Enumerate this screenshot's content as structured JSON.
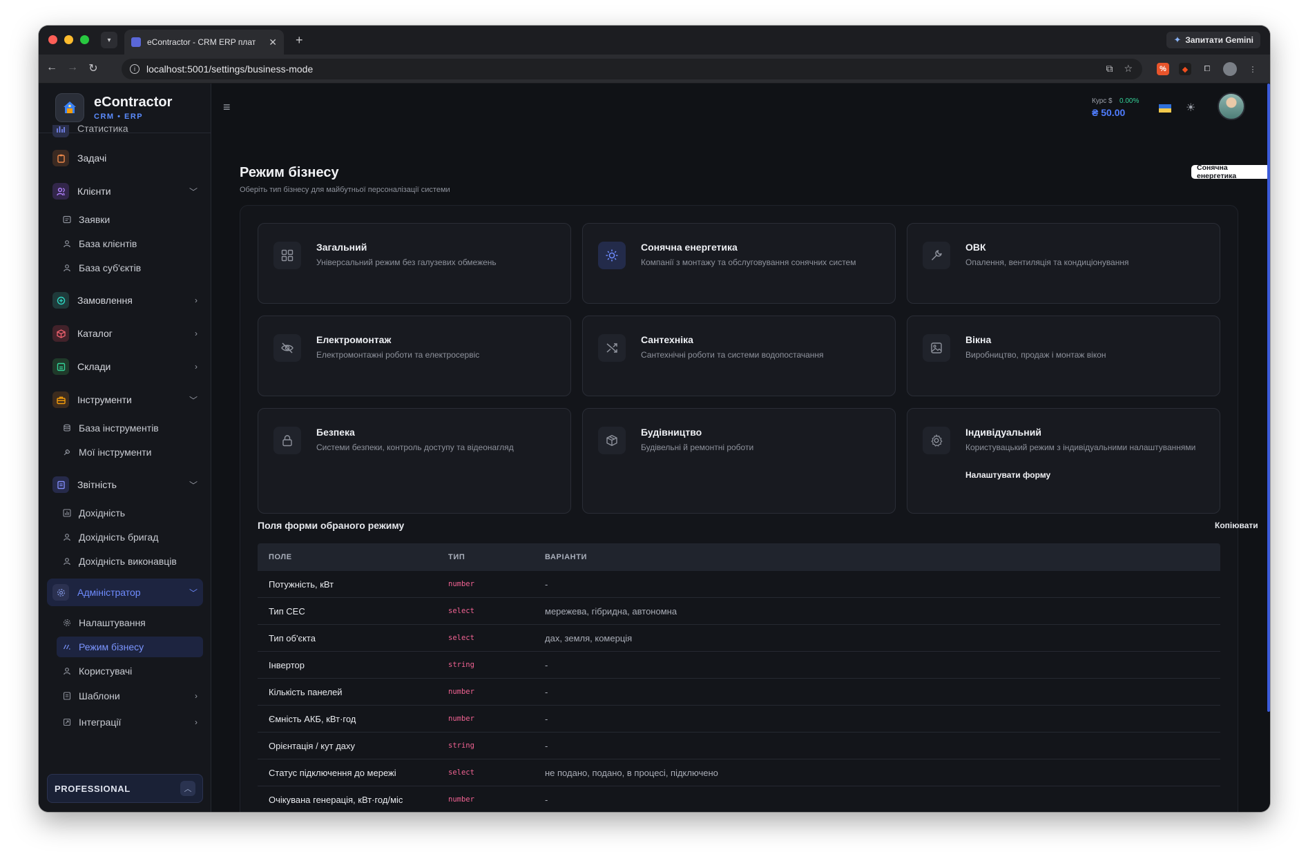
{
  "browser": {
    "tab_title": "eContractor - CRM ERP плат",
    "url": "localhost:5001/settings/business-mode",
    "gemini_label": "Запитати Gemini"
  },
  "brand": {
    "name": "eContractor",
    "sub": "CRM • ERP"
  },
  "sidebar": {
    "items": {
      "stats": "Статистика",
      "tasks": "Задачі",
      "clients": "Клієнти",
      "requests": "Заявки",
      "client_base": "База клієнтів",
      "subjects": "База суб'єктів",
      "orders": "Замовлення",
      "catalog": "Каталог",
      "warehouses": "Склади",
      "tools": "Інструменти",
      "tools_base": "База інструментів",
      "my_tools": "Мої інструменти",
      "reports": "Звітність",
      "income": "Дохідність",
      "income_brigades": "Дохідність бригад",
      "income_executors": "Дохідність виконавців",
      "admin": "Адміністратор",
      "settings": "Налаштування",
      "business_mode": "Режим бізнесу",
      "users": "Користувачі",
      "templates": "Шаблони",
      "integrations": "Інтеграції"
    },
    "plan": "PROFESSIONAL"
  },
  "header": {
    "rate_label": "Курс $",
    "rate_change": "0.00%",
    "rate_value": "₴ 50.00",
    "tooltip": "Сонячна енергетика"
  },
  "page": {
    "title": "Режим бізнесу",
    "subtitle": "Оберіть тип бізнесу для майбутньої персоналізації системи"
  },
  "modes": [
    {
      "title": "Загальний",
      "desc": "Універсальний режим без галузевих обмежень",
      "icon": "grid-icon"
    },
    {
      "title": "Сонячна енергетика",
      "desc": "Компанії з монтажу та обслуговування сонячних систем",
      "icon": "sun-icon",
      "selected": true
    },
    {
      "title": "ОВК",
      "desc": "Опалення, вентиляція та кондиціонування",
      "icon": "wrench-icon"
    },
    {
      "title": "Електромонтаж",
      "desc": "Електромонтажні роботи та електросервіс",
      "icon": "eye-off-icon"
    },
    {
      "title": "Сантехніка",
      "desc": "Сантехнічні роботи та системи водопостачання",
      "icon": "shuffle-icon"
    },
    {
      "title": "Вікна",
      "desc": "Виробництво, продаж і монтаж вікон",
      "icon": "image-icon"
    },
    {
      "title": "Безпека",
      "desc": "Системи безпеки, контроль доступу та відеонагляд",
      "icon": "lock-icon"
    },
    {
      "title": "Будівництво",
      "desc": "Будівельні й ремонтні роботи",
      "icon": "box-icon"
    },
    {
      "title": "Індивідуальний",
      "desc": "Користувацький режим з індивідуальними налаштуваннями",
      "icon": "gear-icon",
      "link": "Налаштувати форму"
    }
  ],
  "fields": {
    "section_title": "Поля форми обраного режиму",
    "copy_label": "Копіювати",
    "headers": [
      "ПОЛЕ",
      "ТИП",
      "ВАРІАНТИ"
    ],
    "rows": [
      [
        "Потужність, кВт",
        "number",
        "-"
      ],
      [
        "Тип СЕС",
        "select",
        "мережева, гібридна, автономна"
      ],
      [
        "Тип об'єкта",
        "select",
        "дах, земля, комерція"
      ],
      [
        "Інвертор",
        "string",
        "-"
      ],
      [
        "Кількість панелей",
        "number",
        "-"
      ],
      [
        "Ємність АКБ, кВт·год",
        "number",
        "-"
      ],
      [
        "Орієнтація / кут даху",
        "string",
        "-"
      ],
      [
        "Статус підключення до мережі",
        "select",
        "не подано, подано, в процесі, підключено"
      ],
      [
        "Очікувана генерація, кВт·год/міс",
        "number",
        "-"
      ]
    ]
  },
  "colors": {
    "accent": "#5b8cff",
    "type_text": "#f06292",
    "positive": "#34d399"
  }
}
